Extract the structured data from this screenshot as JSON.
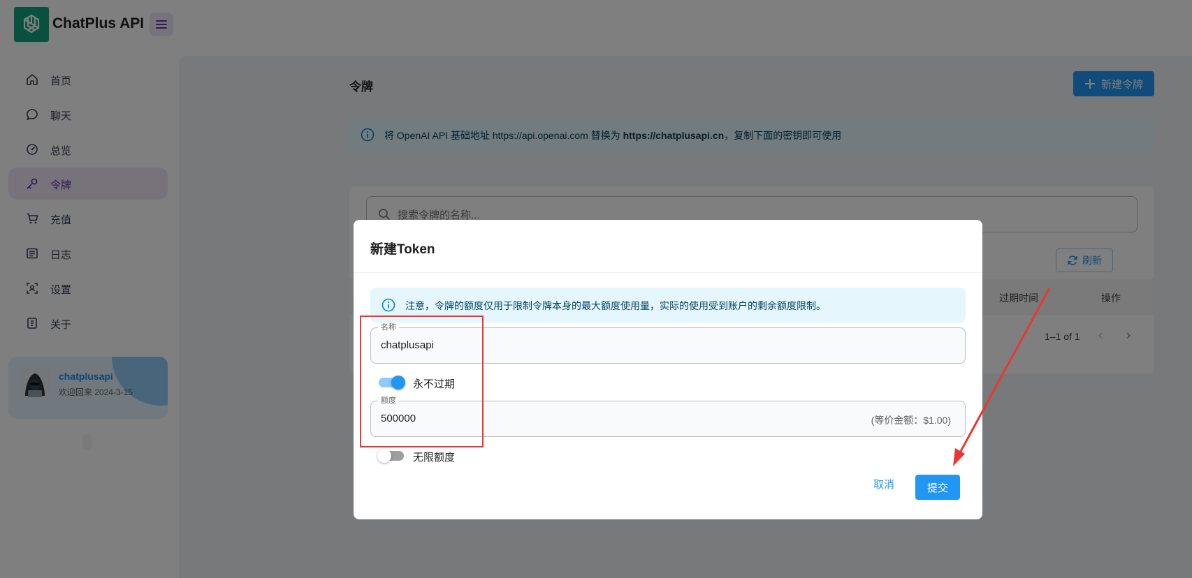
{
  "app": {
    "title": "ChatPlus API",
    "logo_icon": "openai-logo-icon",
    "brand_color": "#10a37f",
    "accent_color": "#2196f3"
  },
  "sidebar": {
    "items": [
      {
        "label": "首页",
        "icon": "home-icon"
      },
      {
        "label": "聊天",
        "icon": "chat-icon"
      },
      {
        "label": "总览",
        "icon": "dashboard-icon"
      },
      {
        "label": "令牌",
        "icon": "key-icon",
        "active": true
      },
      {
        "label": "充值",
        "icon": "cart-icon"
      },
      {
        "label": "日志",
        "icon": "log-icon"
      },
      {
        "label": "设置",
        "icon": "settings-icon"
      },
      {
        "label": "关于",
        "icon": "about-icon"
      }
    ],
    "user": {
      "name": "chatplusapi",
      "welcome": "欢迎回来 2024-3-15"
    }
  },
  "main": {
    "page_title": "令牌",
    "new_token_label": "新建令牌",
    "info": {
      "prefix": "将 OpenAI API 基础地址 https://api.openai.com 替换为 ",
      "url": "https://chatplusapi.cn",
      "suffix": "，复制下面的密钥即可使用"
    },
    "search_placeholder": "搜索令牌的名称...",
    "refresh_label": "刷新",
    "columns": {
      "expire": "过期时间",
      "ops": "操作"
    },
    "pagination": "1–1 of 1"
  },
  "dialog": {
    "title": "新建Token",
    "alert": "注意，令牌的额度仅用于限制令牌本身的最大额度使用量，实际的使用受到账户的剩余额度限制。",
    "name_label": "名称",
    "name_value": "chatplusapi",
    "never_expire_label": "永不过期",
    "never_expire_on": true,
    "quota_label": "额度",
    "quota_value": "500000",
    "quota_adornment": "(等价金额：$1.00)",
    "unlimited_label": "无限额度",
    "unlimited_on": false,
    "cancel_label": "取消",
    "submit_label": "提交"
  }
}
